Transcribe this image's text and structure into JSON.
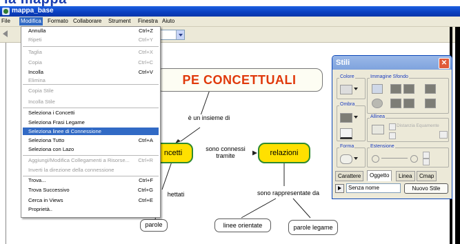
{
  "header_banner": {
    "text": "la mappa"
  },
  "window": {
    "title": "mappa_base"
  },
  "menubar": {
    "items": [
      {
        "label": "File"
      },
      {
        "label": "Modifica"
      },
      {
        "label": "Formato"
      },
      {
        "label": "Collaborare"
      },
      {
        "label": "Strument"
      },
      {
        "label": "Finestra"
      },
      {
        "label": "Aiuto"
      }
    ]
  },
  "edit_menu": {
    "items": [
      {
        "label": "Annulla",
        "shortcut": "Ctrl+Z",
        "enabled": true
      },
      {
        "label": "Ripeti",
        "shortcut": "Ctrl+Y",
        "enabled": false
      },
      {
        "label": "Taglia",
        "shortcut": "Ctrl+X",
        "enabled": false
      },
      {
        "label": "Copia",
        "shortcut": "Ctrl+C",
        "enabled": false
      },
      {
        "label": "Incolla",
        "shortcut": "Ctrl+V",
        "enabled": true
      },
      {
        "label": "Elimina",
        "shortcut": "",
        "enabled": false
      },
      {
        "label": "Copia Stile",
        "shortcut": "",
        "enabled": false
      },
      {
        "label": "Incolla Stile",
        "shortcut": "",
        "enabled": false
      },
      {
        "label": "Seleziona i Concetti",
        "shortcut": "",
        "enabled": true
      },
      {
        "label": "Seleziona Frasi Legame",
        "shortcut": "",
        "enabled": true
      },
      {
        "label": "Seleziona linee di Connessione",
        "shortcut": "",
        "enabled": true,
        "highlighted": true
      },
      {
        "label": "Seleziona Tutto",
        "shortcut": "Ctrl+A",
        "enabled": true
      },
      {
        "label": "Seleziona con Lazo",
        "shortcut": "",
        "enabled": true
      },
      {
        "label": "Aggiungi/Modifica Collegamenti a Risorse...",
        "shortcut": "Ctrl+R",
        "enabled": false
      },
      {
        "label": "Inverti la direzione della connessione",
        "shortcut": "",
        "enabled": false
      },
      {
        "label": "Trova...",
        "shortcut": "Ctrl+F",
        "enabled": true
      },
      {
        "label": "Trova Successivo",
        "shortcut": "Ctrl+G",
        "enabled": true
      },
      {
        "label": "Cerca in Views",
        "shortcut": "Ctrl+E",
        "enabled": true
      },
      {
        "label": "Proprietà..",
        "shortcut": "",
        "enabled": true
      }
    ]
  },
  "concept_map": {
    "main_title": "PE CONCETTUALI",
    "concepts": {
      "left": "ncetti",
      "relazioni": "relazioni",
      "parole": "parole",
      "linee": "linee orientate",
      "parole_legame": "parole legame"
    },
    "links": {
      "insieme": "è un insieme di",
      "connessi": "sono connessi tramite",
      "rappresentate": "sono rappresentate da",
      "hettati": "hettati"
    }
  },
  "styles_panel": {
    "title": "Stili",
    "groups": {
      "colore": "Colore",
      "immagine": "Immagine Sfondo",
      "ombra": "Ombra",
      "allinea": "Allinea",
      "forma": "Forma",
      "estensione": "Estensione"
    },
    "distanzia_label": "Distanzia Equamente",
    "tabs": [
      {
        "label": "Carattere"
      },
      {
        "label": "Oggetto"
      },
      {
        "label": "Linea"
      },
      {
        "label": "Cmap"
      }
    ],
    "active_tab": "Oggetto",
    "style_name_value": "Senza nome",
    "new_style_button": "Nuovo Stile"
  },
  "colors": {
    "titlebar": "#0a3fbf",
    "menu_highlight": "#316ac5",
    "main_title_text": "#e0390b",
    "relazioni_fill": "#ffe000",
    "relazioni_border": "#2f8a2f"
  }
}
